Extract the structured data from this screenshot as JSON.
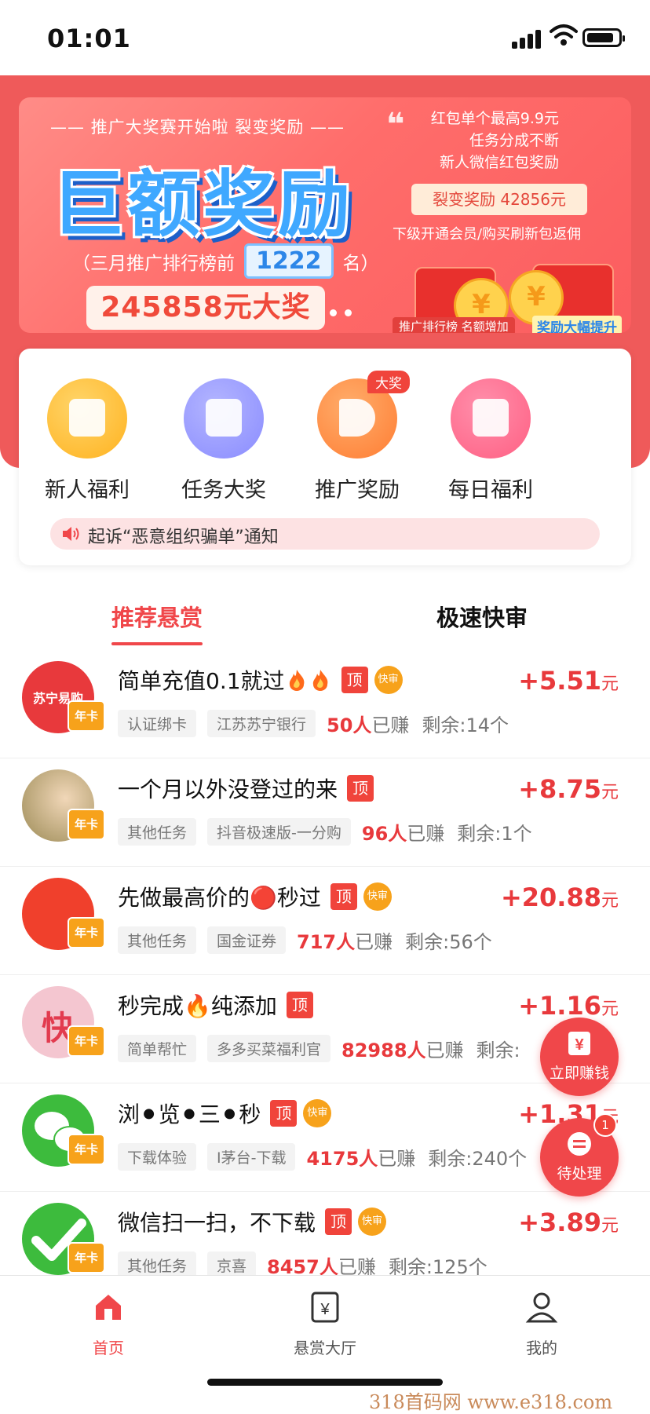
{
  "status_bar": {
    "time": "01:01"
  },
  "banner": {
    "tagline": "推广大奖赛开始啦  裂变奖励",
    "headline": "巨额奖励",
    "rank_prefix": "（三月推广排行榜前",
    "rank_number": "1222",
    "rank_suffix": "名）",
    "prize": "245858元大奖",
    "right_lines": [
      "红包单个最高9.9元",
      "任务分成不断",
      "新人微信红包奖励"
    ],
    "fission_reward": "裂变奖励 42856元",
    "sub_line": "下级开通会员/购买刷新包返佣",
    "footer_left": "推广排行榜 名额增加",
    "footer_right": "奖励大幅提升"
  },
  "quick_menu": {
    "items": [
      {
        "label": "新人福利",
        "icon": "gift-box-icon",
        "color": "#ffb21f"
      },
      {
        "label": "任务大奖",
        "icon": "clipboard-icon",
        "color": "#8a8cff"
      },
      {
        "label": "推广奖励",
        "icon": "megaphone-icon",
        "color": "#ff7d33",
        "badge": "大奖"
      },
      {
        "label": "每日福利",
        "icon": "calendar-check-icon",
        "color": "#ff5f83"
      }
    ],
    "notice": "起诉“恶意组织骗单”通知"
  },
  "tabs": {
    "recommended": "推荐悬赏",
    "fast_review": "极速快审"
  },
  "tasks": [
    {
      "title": "简单充值0.1就过",
      "fires": 2,
      "top": "顶",
      "fast": "快审",
      "tags": [
        "认证绑卡",
        "江苏苏宁银行"
      ],
      "earned_count": "50人",
      "earned_label": "已赚",
      "remaining": "剩余:14个",
      "price": "+5.51",
      "unit": "元",
      "avatar_color": "#e8393c",
      "avatar_text": "苏宁易购",
      "year": "年卡"
    },
    {
      "title": "一个月以外没登过的来",
      "fires": 0,
      "top": "顶",
      "fast": "",
      "tags": [
        "其他任务",
        "抖音极速版-一分购"
      ],
      "earned_count": "96人",
      "earned_label": "已赚",
      "remaining": "剩余:1个",
      "price": "+8.75",
      "unit": "元",
      "avatar_color": "#b99a5a",
      "avatar_text": "",
      "year": "年卡"
    },
    {
      "title": "先做最高价的🔴秒过",
      "fires": 0,
      "top": "顶",
      "fast": "快审",
      "tags": [
        "其他任务",
        "国金证券"
      ],
      "earned_count": "717人",
      "earned_label": "已赚",
      "remaining": "剩余:56个",
      "price": "+20.88",
      "unit": "元",
      "avatar_color": "#f0402c",
      "avatar_text": "",
      "year": "年卡"
    },
    {
      "title": "秒完成🔥纯添加",
      "fires": 0,
      "top": "顶",
      "fast": "",
      "tags": [
        "简单帮忙",
        "多多买菜福利官"
      ],
      "earned_count": "82988人",
      "earned_label": "已赚",
      "remaining": "剩余:",
      "price": "+1.16",
      "unit": "元",
      "avatar_color": "#f4c6d0",
      "avatar_text": "快",
      "year": "年卡"
    },
    {
      "title": "浏⚫览⚫三⚫秒",
      "fires": 0,
      "top": "顶",
      "fast": "快审",
      "tags": [
        "下载体验",
        "I茅台-下载"
      ],
      "earned_count": "4175人",
      "earned_label": "已赚",
      "remaining": "剩余:240个",
      "price": "+1.31",
      "unit": "元",
      "avatar_color": "#3dbb3d",
      "avatar_text": "",
      "year": "年卡"
    },
    {
      "title": "微信扫一扫，不下载",
      "fires": 0,
      "top": "顶",
      "fast": "快审",
      "tags": [
        "其他任务",
        "京喜"
      ],
      "earned_count": "8457人",
      "earned_label": "已赚",
      "remaining": "剩余:125个",
      "price": "+3.89",
      "unit": "元",
      "avatar_color": "#3dbb3d",
      "avatar_text": "",
      "year": "年卡"
    }
  ],
  "floating": {
    "earn_now": "立即赚钱",
    "pending": "待处理",
    "pending_count": "1"
  },
  "bottom_nav": {
    "home": "首页",
    "hall": "悬赏大厅",
    "mine": "我的"
  },
  "watermark": "318首码网  www.e318.com"
}
